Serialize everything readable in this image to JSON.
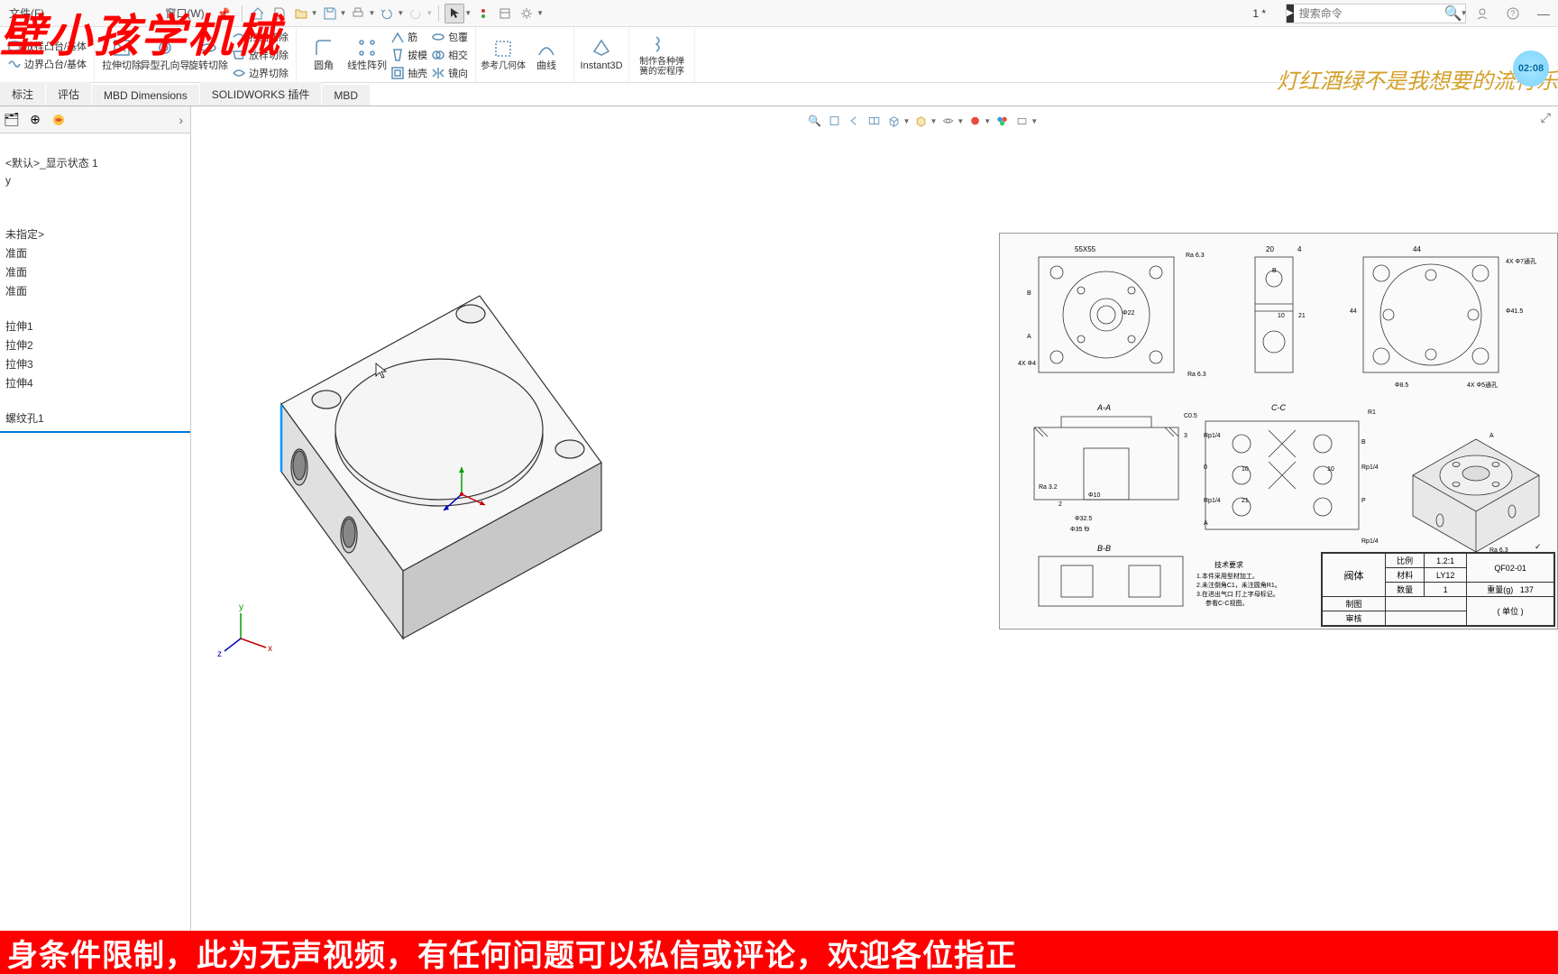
{
  "menu": {
    "file": "文件(F)",
    "window": "窗口(W)",
    "pin_icon": "📌"
  },
  "search": {
    "placeholder": "搜索命令"
  },
  "star": "1 *",
  "ribbon": {
    "extrude_boss": "放样凸台/基体",
    "boundary_boss": "边界凸台/基体",
    "extrude_cut": "拉伸切除",
    "hole_wizard": "异型孔向导",
    "revolve_cut": "旋转切除",
    "sweep_cut": "扫描切除",
    "loft_cut": "放样切除",
    "boundary_cut": "边界切除",
    "fillet": "圆角",
    "linear_pattern": "线性阵列",
    "rib": "筋",
    "draft": "拔模",
    "shell": "抽壳",
    "wrap": "包覆",
    "intersect": "相交",
    "mirror": "镜向",
    "ref_geom": "参考几何体",
    "curves": "曲线",
    "instant3d": "Instant3D",
    "macro": "制作各种弹簧的宏程序"
  },
  "tabs": {
    "annotate": "标注",
    "evaluate": "评估",
    "mbd_dim": "MBD Dimensions",
    "sw_addins": "SOLIDWORKS 插件",
    "mbd": "MBD"
  },
  "tree": {
    "display_state": "<默认>_显示状态 1",
    "item_y": "y",
    "not_specified": "未指定>",
    "plane1": "准面",
    "plane2": "准面",
    "plane3": "准面",
    "feat1": "拉伸1",
    "feat2": "拉伸2",
    "feat3": "拉伸3",
    "feat4": "拉伸4",
    "feat5": "螺纹孔1"
  },
  "drawing": {
    "dim_55x55": "55X55",
    "dim_ra63": "Ra 6.3",
    "dim_phi22": "Φ22",
    "dim_4xphi4": "4X Φ4",
    "dim_20": "20",
    "dim_4": "4",
    "dim_21": "21",
    "dim_10": "10",
    "dim_44": "44",
    "dim_4xphi7": "4X Φ7通孔",
    "dim_phi415": "Φ41.5",
    "dim_phi85": "Φ8.5",
    "dim_4xphi5": "4X Φ5通孔",
    "sec_aa": "A-A",
    "sec_bb": "B-B",
    "sec_cc": "C-C",
    "dim_c05": "C0.5",
    "dim_r1": "R1",
    "dim_rp14": "Rp1/4",
    "dim_ra32": "Ra 3.2",
    "dim_phi10": "Φ10",
    "dim_phi325": "Φ32.5",
    "dim_phi35": "Φ35 f9",
    "dim_0": "0",
    "dim_b": "B",
    "dim_a": "A",
    "dim_p": "P",
    "dim_3": "3",
    "dim_2": "2",
    "tech_req_title": "技术要求",
    "tech_req_1": "1.本件采用型材加工。",
    "tech_req_2": "2.未注倒角C1，未注圆角R1。",
    "tech_req_3": "3.在进出气口 打上字母标记。",
    "tech_req_4": "参看C-C视图。",
    "part_name": "阀体",
    "scale_label": "比例",
    "scale_val": "1.2:1",
    "dwg_no": "QF02-01",
    "material_label": "材料",
    "material_val": "LY12",
    "qty_label": "数量",
    "qty_val": "1",
    "weight_label": "重量(g)",
    "weight_val": "137",
    "drawn_label": "制图",
    "check_label": "审核",
    "unit_label": "( 单位 )"
  },
  "overlay": {
    "title": "壁小孩学机械",
    "lyric": "灯红酒绿不是我想要的流行乐",
    "bottom": "身条件限制，此为无声视频，有任何问题可以私信或评论，欢迎各位指正",
    "timer": "02:08"
  },
  "triad": {
    "x": "x",
    "y": "y",
    "z": "z"
  }
}
